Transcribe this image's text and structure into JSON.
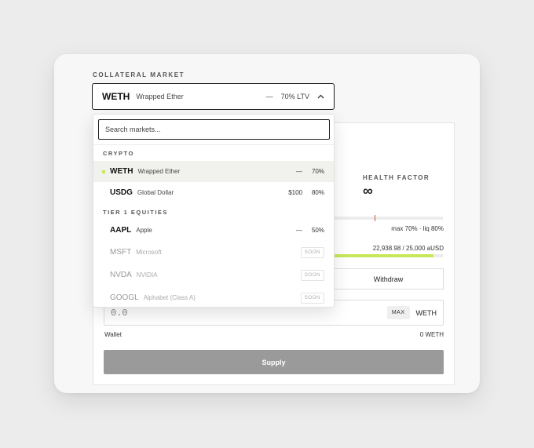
{
  "collateral_market": {
    "label": "COLLATERAL MARKET",
    "selected": {
      "symbol": "WETH",
      "name": "Wrapped Ether",
      "price": "—",
      "ltv": "70% LTV"
    }
  },
  "dropdown": {
    "search_placeholder": "Search markets...",
    "groups": [
      {
        "label": "CRYPTO",
        "items": [
          {
            "symbol": "WETH",
            "name": "Wrapped Ether",
            "price": "—",
            "ltv": "70%",
            "selected": true
          },
          {
            "symbol": "USDG",
            "name": "Global Dollar",
            "price": "$100",
            "ltv": "80%"
          }
        ]
      },
      {
        "label": "TIER 1 EQUITIES",
        "items": [
          {
            "symbol": "AAPL",
            "name": "Apple",
            "price": "—",
            "ltv": "50%"
          },
          {
            "symbol": "MSFT",
            "name": "Microsoft",
            "badge": "SOON"
          },
          {
            "symbol": "NVDA",
            "name": "NVIDIA",
            "badge": "SOON"
          },
          {
            "symbol": "GOOGL",
            "name": "Alphabet (Class A)",
            "badge": "SOON"
          }
        ]
      }
    ]
  },
  "health_factor": {
    "label": "HEALTH FACTOR",
    "value": "∞",
    "caption": "max 70% · liq 80%"
  },
  "borrow_limit": {
    "caption": "22,938.98 / 25,000 aUSD",
    "fill_fraction": 0.917
  },
  "tabs": {
    "withdraw": "Withdraw"
  },
  "amount": {
    "value": "0.0",
    "max_label": "MAX",
    "asset": "WETH"
  },
  "wallet": {
    "label": "Wallet",
    "value": "0 WETH"
  },
  "supply_button": "Supply",
  "colors": {
    "accent": "#c8e85a",
    "liq_marker": "#c9583c",
    "supply_disabled": "#9a9a9a"
  },
  "icons": {
    "select_chevron": "chevron-up-icon",
    "selected_marker": "square-dot-icon"
  }
}
